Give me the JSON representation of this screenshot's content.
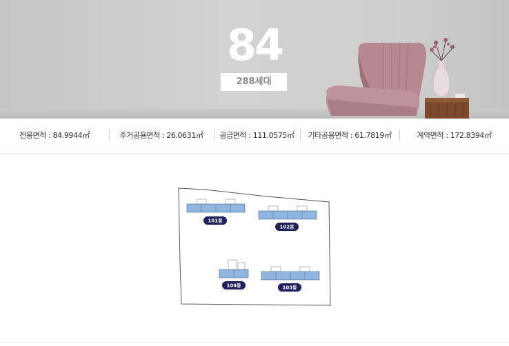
{
  "hero": {
    "size": "84",
    "households": "288세대"
  },
  "areas": [
    {
      "label": "전용면적 : 84.9944㎡"
    },
    {
      "label": "주거공용면적 :  26.0631㎡"
    },
    {
      "label": "공급면적 : 111.0575㎡"
    },
    {
      "label": "기타공용면적 : 61.7819㎡"
    },
    {
      "label": "계약면적 : 172.8394㎡"
    }
  ],
  "site_map": {
    "buildings": [
      {
        "label": "101동"
      },
      {
        "label": "102동"
      },
      {
        "label": "104동"
      },
      {
        "label": "103동"
      }
    ]
  },
  "colors": {
    "building_fill": "#8fb6de",
    "label_bg": "#1f1f5c",
    "hero_text": "#ffffff"
  }
}
